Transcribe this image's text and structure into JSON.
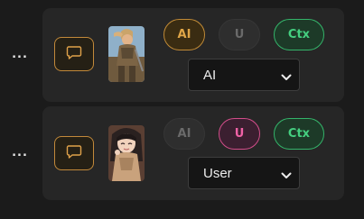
{
  "rows": [
    {
      "more_label": "...",
      "message_icon": "chat-bubble-icon",
      "thumbnail": "character-portrait-blonde-warrior",
      "ai_label": "AI",
      "ai_active": true,
      "user_label": "U",
      "user_active": false,
      "ctx_label": "Ctx",
      "ctx_active": true,
      "role_value": "AI"
    },
    {
      "more_label": "...",
      "message_icon": "chat-bubble-icon",
      "thumbnail": "character-portrait-dark-haired-girl",
      "ai_label": "AI",
      "ai_active": false,
      "user_label": "U",
      "user_active": true,
      "ctx_label": "Ctx",
      "ctx_active": true,
      "role_value": "User"
    }
  ],
  "colors": {
    "background": "#1b1b1b",
    "card": "#262626",
    "ai_accent": "#e0a647",
    "user_accent": "#f062a6",
    "ctx_accent": "#45cf80",
    "message_button_border": "#c2893a"
  }
}
